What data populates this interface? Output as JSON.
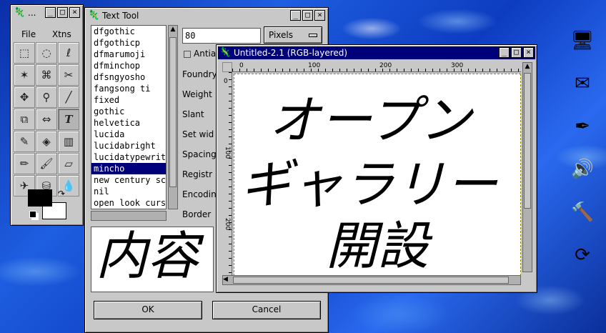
{
  "toolbox": {
    "title": "...",
    "menu": [
      "File",
      "Xtns"
    ],
    "tools": [
      {
        "icon": "rect-select-icon",
        "glyph": "⬚"
      },
      {
        "icon": "ellipse-select-icon",
        "glyph": "◌"
      },
      {
        "icon": "free-select-icon",
        "glyph": "ℓ"
      },
      {
        "icon": "fuzzy-select-icon",
        "glyph": "✶"
      },
      {
        "icon": "bezier-select-icon",
        "glyph": "⌘"
      },
      {
        "icon": "scissors-icon",
        "glyph": "✂"
      },
      {
        "icon": "move-icon",
        "glyph": "✥"
      },
      {
        "icon": "magnify-icon",
        "glyph": "⚲"
      },
      {
        "icon": "crop-icon",
        "glyph": "╱"
      },
      {
        "icon": "transform-icon",
        "glyph": "⧉"
      },
      {
        "icon": "flip-icon",
        "glyph": "⇔"
      },
      {
        "icon": "text-icon",
        "glyph": "T"
      },
      {
        "icon": "color-picker-icon",
        "glyph": "✎"
      },
      {
        "icon": "bucket-fill-icon",
        "glyph": "◈"
      },
      {
        "icon": "gradient-icon",
        "glyph": "▥"
      },
      {
        "icon": "pencil-icon",
        "glyph": "✏"
      },
      {
        "icon": "paintbrush-icon",
        "glyph": "🖌"
      },
      {
        "icon": "eraser-icon",
        "glyph": "▱"
      },
      {
        "icon": "airbrush-icon",
        "glyph": "✈"
      },
      {
        "icon": "clone-icon",
        "glyph": "⛁"
      },
      {
        "icon": "convolve-icon",
        "glyph": "💧"
      }
    ]
  },
  "text_tool": {
    "title": "Text Tool",
    "size_value": "80",
    "units": "Pixels",
    "antialias": "Antia",
    "fonts": [
      "dfgothic",
      "dfgothicp",
      "dfmarumoji",
      "dfminchop",
      "dfsngyosho",
      "fangsong ti",
      "fixed",
      "gothic",
      "helvetica",
      "lucida",
      "lucidabright",
      "lucidatypewrit",
      "mincho",
      "new century sc",
      "nil",
      "open look curs"
    ],
    "selected_font": "mincho",
    "fields": [
      "Foundry",
      "Weight",
      "Slant",
      "Set wid",
      "Spacing",
      "Registr",
      "Encodin",
      "Border"
    ],
    "preview": "内容",
    "ok": "OK",
    "cancel": "Cancel"
  },
  "image_window": {
    "title": "Untitled-2.1 (RGB-layered)",
    "ruler_h": [
      "0",
      "100",
      "200",
      "300"
    ],
    "ruler_v": [
      "0",
      "100",
      "200"
    ],
    "lines": [
      "オープン",
      "ギャラリー",
      "開設"
    ]
  },
  "desktop_icons": [
    "monitor-icon",
    "mail-icon",
    "pen-icon",
    "speaker-icon",
    "hammer-icon",
    "refresh-icon"
  ]
}
